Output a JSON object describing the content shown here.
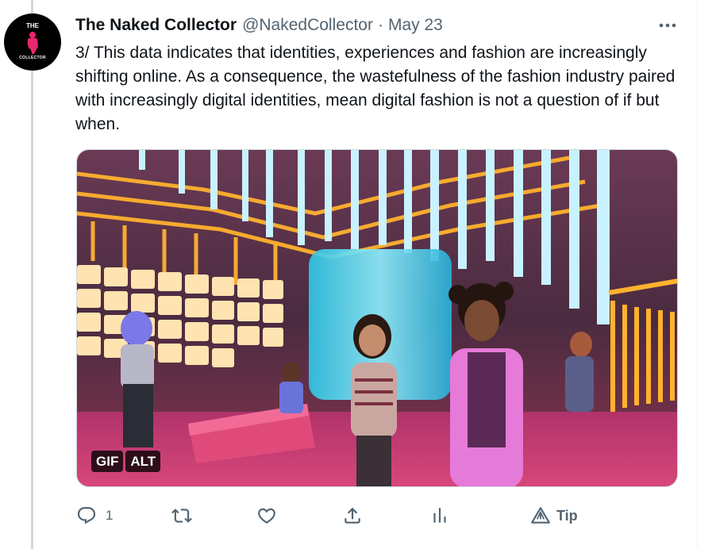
{
  "author": {
    "name": "The Naked Collector",
    "handle": "@NakedCollector",
    "separator": "·",
    "date": "May 23",
    "avatar_text_top": "THE",
    "avatar_text_bottom": "COLLECTOR"
  },
  "tweet": {
    "text": "3/ This data indicates that identities, experiences and fashion are increasingly shifting online. As a consequence, the wastefulness of the fashion industry paired with increasingly digital identities, mean digital fashion is not a question of if but when."
  },
  "media": {
    "type": "gif",
    "badges": [
      "GIF",
      "ALT"
    ]
  },
  "actions": {
    "reply_count": "1",
    "tip_label": "Tip"
  },
  "icons": {
    "more": "more-icon",
    "reply": "reply-icon",
    "retweet": "retweet-icon",
    "like": "like-icon",
    "share": "share-icon",
    "analytics": "analytics-icon",
    "tip": "tip-icon"
  },
  "colors": {
    "text": "#0f1419",
    "secondary": "#536471",
    "avatar_bg": "#000000",
    "avatar_accent": "#e8266e",
    "thread_line": "#cfd9de"
  }
}
